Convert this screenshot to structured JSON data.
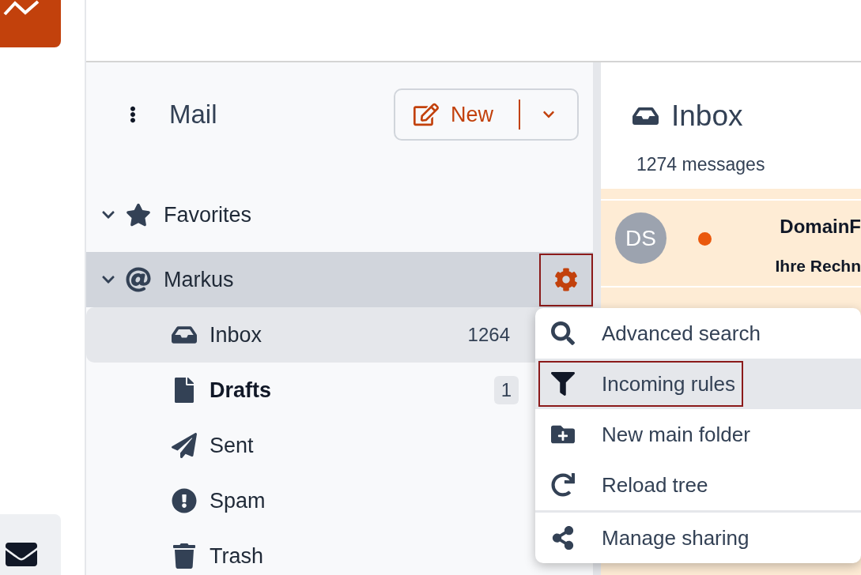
{
  "sidebar": {
    "title": "Mail",
    "new_button": {
      "label": "New"
    },
    "tree": [
      {
        "label": "Favorites",
        "expanded": true,
        "highlighted": false,
        "settings_open": false
      },
      {
        "label": "Markus",
        "expanded": true,
        "highlighted": true,
        "settings_open": true,
        "children": [
          {
            "label": "Inbox",
            "count": "1264",
            "selected": true,
            "has_unread": false
          },
          {
            "label": "Drafts",
            "count": "1",
            "selected": false,
            "has_unread": true
          },
          {
            "label": "Sent",
            "selected": false,
            "has_unread": false
          },
          {
            "label": "Spam",
            "selected": false,
            "has_unread": false
          },
          {
            "label": "Trash",
            "selected": false,
            "has_unread": false
          }
        ]
      }
    ]
  },
  "menu": {
    "items": [
      {
        "label": "Advanced search",
        "selected": false,
        "separated": false
      },
      {
        "label": "Incoming rules",
        "selected": true,
        "separated": false
      },
      {
        "label": "New main folder",
        "selected": false,
        "separated": false
      },
      {
        "label": "Reload tree",
        "selected": false,
        "separated": false
      },
      {
        "label": "Manage sharing",
        "selected": false,
        "separated": true
      }
    ]
  },
  "content": {
    "title": "Inbox",
    "count": "1274 messages",
    "messages": [
      {
        "avatar": "DS",
        "sender": "DomainF",
        "subject": "Ihre Rechn",
        "unread": true
      }
    ]
  }
}
